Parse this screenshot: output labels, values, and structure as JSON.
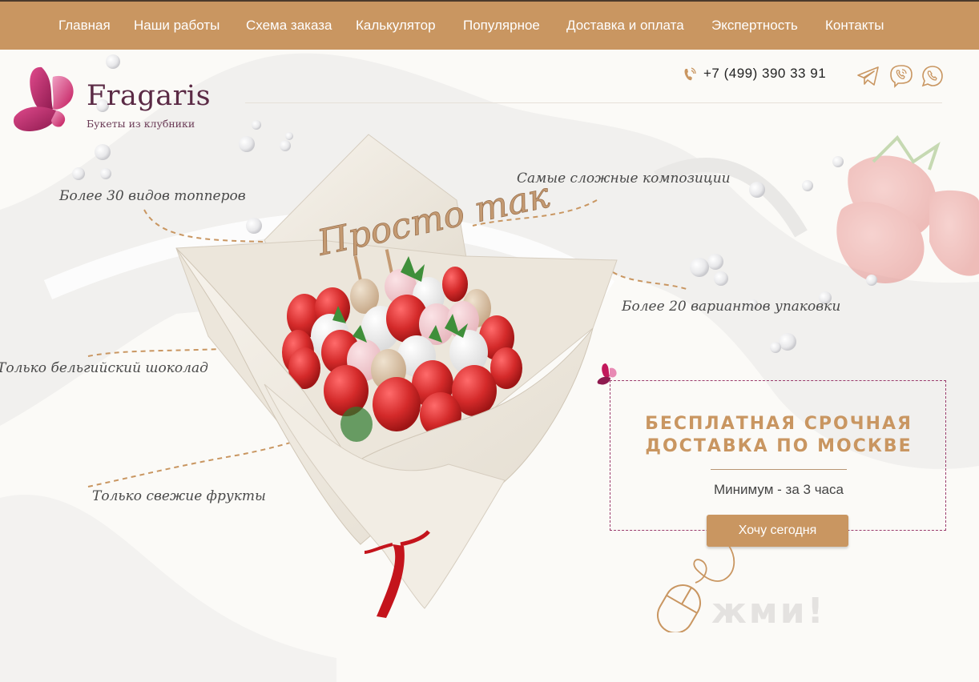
{
  "nav": {
    "items": [
      {
        "label": "Главная"
      },
      {
        "label": "Наши работы"
      },
      {
        "label": "Схема заказа"
      },
      {
        "label": "Калькулятор"
      },
      {
        "label": "Популярное"
      },
      {
        "label": "Доставка и оплата"
      },
      {
        "label": "Экспертность"
      },
      {
        "label": "Контакты"
      }
    ]
  },
  "logo": {
    "name": "Fragaris",
    "tagline": "Букеты из клубники"
  },
  "header": {
    "phone": "+7 (499) 390 33 91",
    "phone_icon": "phone-icon",
    "socials": [
      "telegram-icon",
      "viber-icon",
      "whatsapp-icon"
    ]
  },
  "features": {
    "toppers": "Более 30 видов топперов",
    "compositions": "Самые сложные композиции",
    "packaging": "Более 20 вариантов упаковки",
    "chocolate": "Только бельгийский шоколад",
    "fruits": "Только свежие фрукты"
  },
  "topper_text": "Просто так",
  "promo": {
    "title_line1": "Бесплатная срочная",
    "title_line2": "доставка по Москве",
    "subtitle": "Минимум - за 3 часа",
    "cta": "Хочу сегодня",
    "press_hint": "жми!"
  },
  "colors": {
    "nav_bg": "#c99661",
    "accent": "#c99661",
    "brand_purple": "#5b2a45",
    "logo_pink": "#c2185b",
    "strawberry": "#d42a2a"
  }
}
